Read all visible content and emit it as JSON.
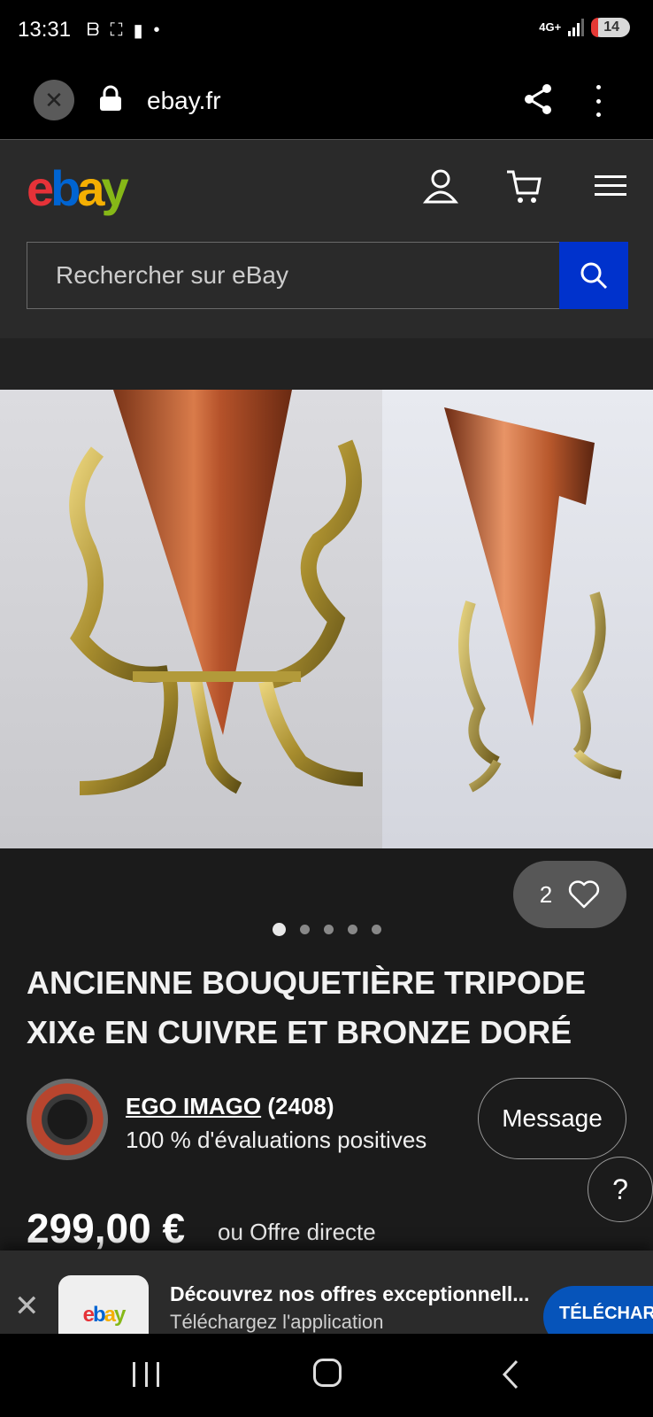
{
  "status_bar": {
    "time": "13:31",
    "network": "4G+",
    "battery": "14"
  },
  "browser": {
    "url": "ebay.fr"
  },
  "header": {
    "logo_letters": [
      "e",
      "b",
      "a",
      "y"
    ],
    "search_placeholder": "Rechercher sur eBay"
  },
  "listing": {
    "watch_count": "2",
    "image_count": 5,
    "active_image_index": 0,
    "title": "ANCIENNE BOUQUETIÈRE TRIPODE XIXe EN CUIVRE ET BRONZE DORÉ",
    "seller": {
      "name": "EGO IMAGO",
      "feedback_count": "(2408)",
      "positive": "100 % d'évaluations positives"
    },
    "message_label": "Message",
    "help_label": "?",
    "price": "299,00 €",
    "price_sub": "ou Offre directe"
  },
  "app_banner": {
    "close": "✕",
    "title": "Découvrez nos offres exceptionnell...",
    "subtitle": "Téléchargez l'application",
    "cta": "TÉLÉCHARGER"
  },
  "colors": {
    "accent_blue": "#0032cc",
    "cta_blue": "#0654ba",
    "logo_red": "#e53238",
    "logo_blue": "#0064d2",
    "logo_yellow": "#f5af02",
    "logo_green": "#86b817"
  }
}
